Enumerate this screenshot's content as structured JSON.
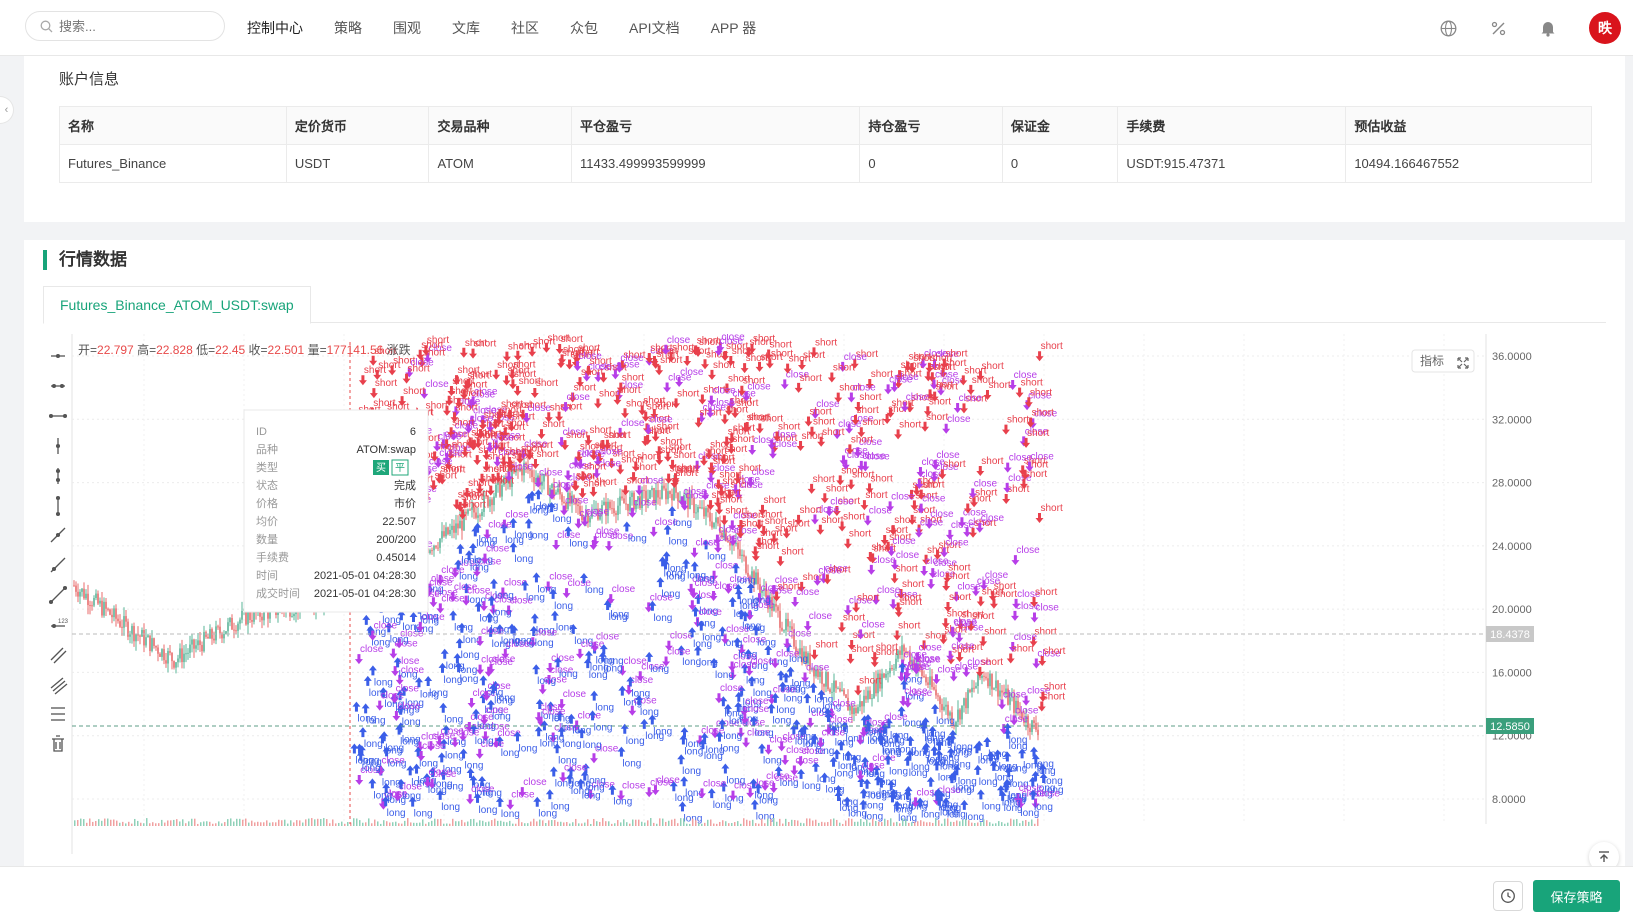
{
  "topbar": {
    "search_placeholder": "搜索...",
    "nav": [
      "控制中心",
      "策略",
      "围观",
      "文库",
      "社区",
      "众包",
      "API文档",
      "APP 器"
    ],
    "icons": [
      "globe-icon",
      "percent-icon",
      "bell-icon"
    ],
    "avatar_text": "昳"
  },
  "account": {
    "title": "账户信息",
    "headers": [
      "名称",
      "定价货币",
      "交易品种",
      "平仓盈亏",
      "持仓盈亏",
      "保证金",
      "手续费",
      "预估收益"
    ],
    "row": [
      "Futures_Binance",
      "USDT",
      "ATOM",
      "11433.499993599999",
      "0",
      "0",
      "USDT:915.47371",
      "10494.166467552"
    ]
  },
  "market": {
    "title": "行情数据",
    "tab_label": "Futures_Binance_ATOM_USDT:swap",
    "indicator_label": "指标",
    "ohlc_prefix_open": "开=",
    "ohlc_open": "22.797",
    "ohlc_prefix_high": "高=",
    "ohlc_high": "22.828",
    "ohlc_prefix_low": "低=",
    "ohlc_low": "22.45",
    "ohlc_prefix_close": "收=",
    "ohlc_close": "22.501",
    "ohlc_prefix_vol": "量=",
    "ohlc_vol": "177141.56",
    "ohlc_suffix": "涨跌",
    "marker_long": "long",
    "marker_short": "short",
    "marker_close": "close"
  },
  "tooltip": {
    "rows": [
      {
        "k": "ID",
        "v": "6"
      },
      {
        "k": "品种",
        "v": "ATOM:swap"
      },
      {
        "k": "类型",
        "v": ""
      },
      {
        "k": "状态",
        "v": "完成"
      },
      {
        "k": "价格",
        "v": "市价"
      },
      {
        "k": "均价",
        "v": "22.507"
      },
      {
        "k": "数量",
        "v": "200/200"
      },
      {
        "k": "手续费",
        "v": "0.45014"
      },
      {
        "k": "时间",
        "v": "2021-05-01 04:28:30"
      },
      {
        "k": "成交时间",
        "v": "2021-05-01 04:28:30"
      }
    ],
    "badge_buy": "买",
    "badge_flat": "平"
  },
  "chart_data": {
    "type": "candlestick",
    "y_ticks": [
      "36.0000",
      "32.0000",
      "28.0000",
      "24.0000",
      "20.0000",
      "16.0000",
      "12.0000",
      "8.0000"
    ],
    "ylim": [
      8,
      36
    ],
    "price_marker_1": "18.4378",
    "price_marker_2": "12.5850",
    "colors": {
      "up": "#5ab497",
      "down": "#e86b6b",
      "long": "#3b5ee8",
      "short": "#e8404c",
      "close": "#b73ee8"
    }
  },
  "footer": {
    "save_label": "保存策略"
  }
}
